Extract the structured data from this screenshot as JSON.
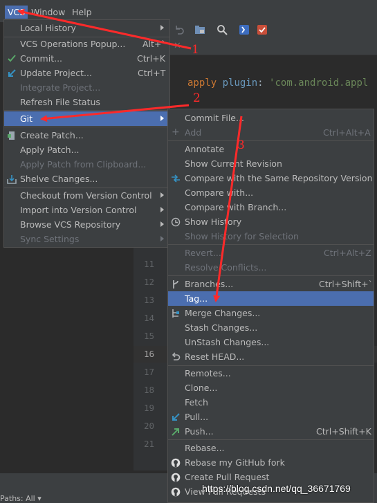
{
  "menubar": {
    "items": [
      {
        "label": "VCS",
        "active": true
      },
      {
        "label": "Window",
        "active": false
      },
      {
        "label": "Help",
        "active": false
      }
    ]
  },
  "editor": {
    "code": {
      "kw": "apply",
      "ident": "plugin",
      "colon": ": ",
      "str": "'com.android.appl"
    },
    "line_numbers": [
      "11",
      "12",
      "13",
      "14",
      "15",
      "16",
      "17",
      "18",
      "19",
      "20",
      "21"
    ],
    "current_line": "16",
    "partial_line_num": "10"
  },
  "vcs_menu": {
    "items": [
      {
        "label": "Local History",
        "submenu": true,
        "disabled": false
      },
      {
        "label": "VCS Operations Popup...",
        "shortcut": "Alt+`",
        "disabled": false
      },
      {
        "label": "Commit...",
        "shortcut": "Ctrl+K",
        "icon": "check-icon",
        "disabled": false
      },
      {
        "label": "Update Project...",
        "shortcut": "Ctrl+T",
        "icon": "update-arrow-icon",
        "disabled": false
      },
      {
        "label": "Integrate Project...",
        "disabled": true
      },
      {
        "label": "Refresh File Status",
        "disabled": false
      },
      {
        "label": "Git",
        "submenu": true,
        "selected": true
      },
      {
        "label": "Create Patch...",
        "icon": "patch-icon",
        "disabled": false
      },
      {
        "label": "Apply Patch...",
        "disabled": false
      },
      {
        "label": "Apply Patch from Clipboard...",
        "disabled": true
      },
      {
        "label": "Shelve Changes...",
        "icon": "shelve-icon",
        "disabled": false
      },
      {
        "label": "Checkout from Version Control",
        "submenu": true,
        "disabled": false
      },
      {
        "label": "Import into Version Control",
        "submenu": true,
        "disabled": false
      },
      {
        "label": "Browse VCS Repository",
        "submenu": true,
        "disabled": false
      },
      {
        "label": "Sync Settings",
        "submenu": true,
        "disabled": true
      }
    ]
  },
  "git_menu": {
    "items": [
      {
        "label": "Commit File...",
        "disabled": false
      },
      {
        "label": "Add",
        "shortcut": "Ctrl+Alt+A",
        "icon": "plus-icon",
        "disabled": true
      },
      {
        "label": "Annotate",
        "disabled": false
      },
      {
        "label": "Show Current Revision",
        "disabled": false
      },
      {
        "label": "Compare with the Same Repository Version",
        "icon": "compare-icon",
        "disabled": false
      },
      {
        "label": "Compare with...",
        "disabled": false
      },
      {
        "label": "Compare with Branch...",
        "disabled": false
      },
      {
        "label": "Show History",
        "icon": "clock-icon",
        "disabled": false
      },
      {
        "label": "Show History for Selection",
        "disabled": true
      },
      {
        "label": "Revert...",
        "shortcut": "Ctrl+Alt+Z",
        "disabled": true
      },
      {
        "label": "Resolve Conflicts...",
        "disabled": true
      },
      {
        "label": "Branches...",
        "shortcut": "Ctrl+Shift+`",
        "icon": "branch-icon",
        "disabled": false
      },
      {
        "label": "Tag...",
        "selected": true
      },
      {
        "label": "Merge Changes...",
        "icon": "merge-icon",
        "disabled": false
      },
      {
        "label": "Stash Changes...",
        "disabled": false
      },
      {
        "label": "UnStash Changes...",
        "disabled": false
      },
      {
        "label": "Reset HEAD...",
        "icon": "reset-icon",
        "disabled": false
      },
      {
        "label": "Remotes...",
        "disabled": false
      },
      {
        "label": "Clone...",
        "disabled": false
      },
      {
        "label": "Fetch",
        "disabled": false
      },
      {
        "label": "Pull...",
        "icon": "pull-icon",
        "disabled": false
      },
      {
        "label": "Push...",
        "shortcut": "Ctrl+Shift+K",
        "icon": "push-icon",
        "disabled": false
      },
      {
        "label": "Rebase...",
        "disabled": false
      },
      {
        "label": "Rebase my GitHub fork",
        "icon": "github-icon",
        "disabled": false
      },
      {
        "label": "Create Pull Request",
        "icon": "github-icon",
        "disabled": false
      },
      {
        "label": "View Pull Requests",
        "icon": "github-icon",
        "disabled": false
      }
    ]
  },
  "bottombar": {
    "label": "Paths: All"
  },
  "annotations": [
    "1",
    "2",
    "3"
  ],
  "watermark": "https://blog.csdn.net/qq_36671769",
  "colors": {
    "accent": "#4b6eaf",
    "annotation": "#ff2a2a",
    "background": "#3c3f41"
  }
}
